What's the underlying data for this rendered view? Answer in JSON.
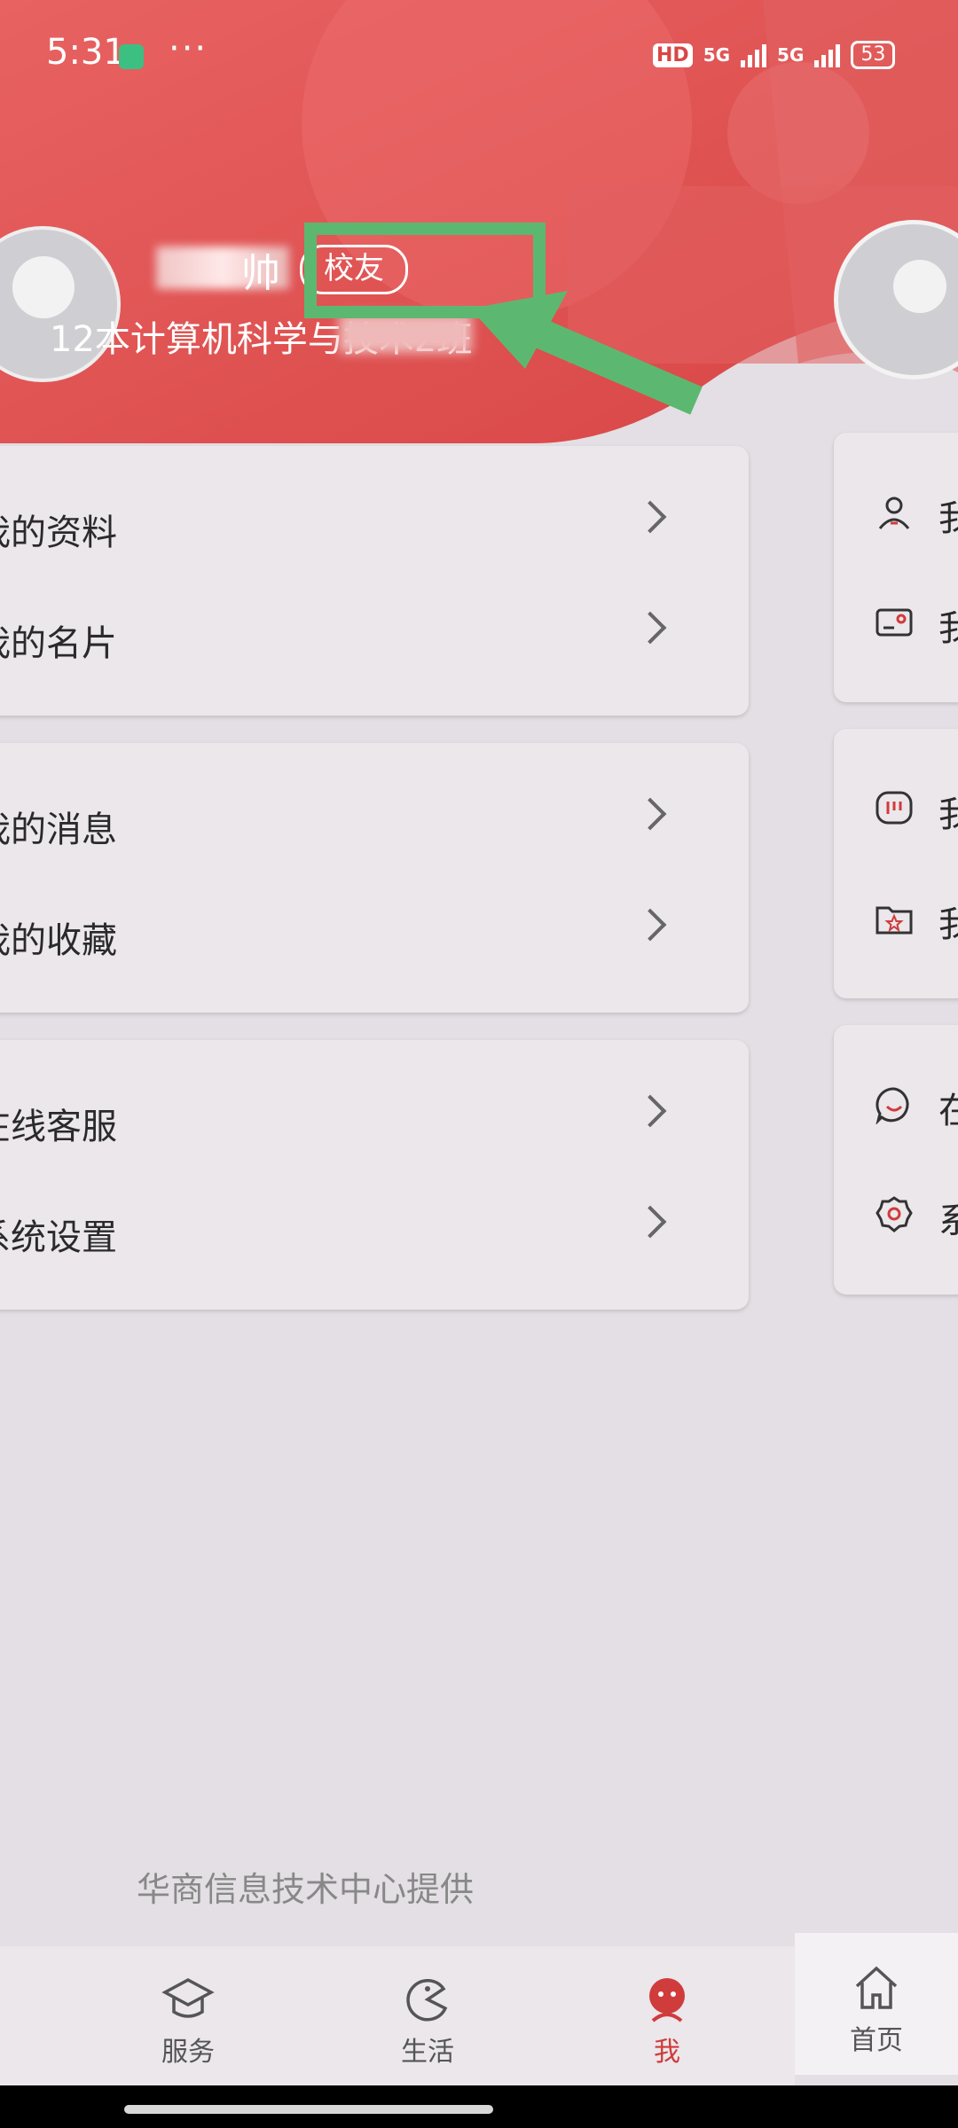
{
  "status_bar": {
    "time": "5:31",
    "dots": "···",
    "hd_label": "HD",
    "signal1": "5G",
    "signal2": "5G",
    "battery": "53"
  },
  "profile": {
    "name_visible_char": "帅",
    "badge": "校友",
    "class_line": "12本计算机科学与技术2班"
  },
  "menu": {
    "items": [
      {
        "label": "我的资料"
      },
      {
        "label": "我的名片"
      },
      {
        "label": "我的消息"
      },
      {
        "label": "我的收藏"
      },
      {
        "label": "在线客服"
      },
      {
        "label": "系统设置"
      }
    ],
    "truncated_labels": [
      "我的资料",
      "我的名片",
      "我的消息",
      "我的收藏",
      "在线客服",
      "系统设置"
    ]
  },
  "right_panel": {
    "items": [
      {
        "icon": "person-icon",
        "label": "我"
      },
      {
        "icon": "card-icon",
        "label": "我"
      },
      {
        "icon": "message-icon",
        "label": "我"
      },
      {
        "icon": "folder-star-icon",
        "label": "我"
      },
      {
        "icon": "chat-smile-icon",
        "label": "在"
      },
      {
        "icon": "gear-icon",
        "label": "系"
      }
    ]
  },
  "footer": "华商信息技术中心提供",
  "tabbar": {
    "tabs": [
      {
        "label": "服务",
        "icon": "graduation-cap-icon"
      },
      {
        "label": "生活",
        "icon": "pacman-icon"
      },
      {
        "label": "我",
        "icon": "face-icon",
        "active": true
      }
    ],
    "right_tab": {
      "label": "首页",
      "icon": "home-icon"
    }
  },
  "colors": {
    "accent": "#d03b3b",
    "header": "#e05252",
    "annotation_green": "#5cb870"
  }
}
